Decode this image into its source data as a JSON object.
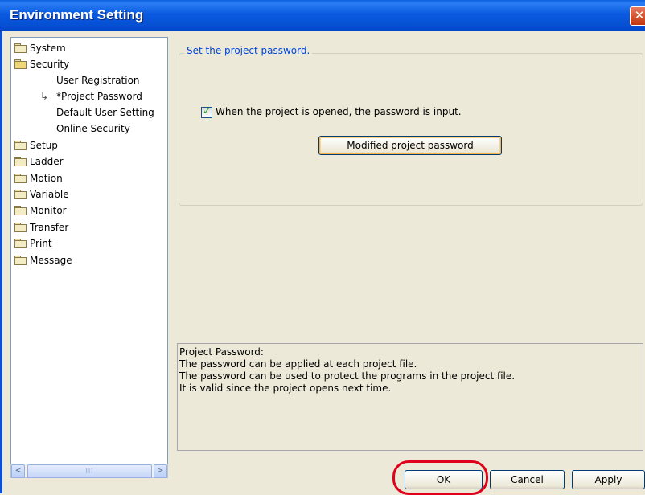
{
  "window": {
    "title": "Environment Setting",
    "close_icon": "close-icon"
  },
  "tree": {
    "items": [
      {
        "label": "System",
        "level": 0,
        "icon": "folder-icon"
      },
      {
        "label": "Security",
        "level": 0,
        "icon": "folder-open-icon"
      },
      {
        "label": "User Registration",
        "level": 1
      },
      {
        "label": "*Project Password",
        "level": 1,
        "icon": "arrow-icon",
        "selected": true
      },
      {
        "label": "Default User Setting",
        "level": 1
      },
      {
        "label": "Online Security",
        "level": 1
      },
      {
        "label": "Setup",
        "level": 0,
        "icon": "folder-icon"
      },
      {
        "label": "Ladder",
        "level": 0,
        "icon": "folder-icon"
      },
      {
        "label": "Motion",
        "level": 0,
        "icon": "folder-icon"
      },
      {
        "label": "Variable",
        "level": 0,
        "icon": "folder-icon"
      },
      {
        "label": "Monitor",
        "level": 0,
        "icon": "folder-icon"
      },
      {
        "label": "Transfer",
        "level": 0,
        "icon": "folder-icon"
      },
      {
        "label": "Print",
        "level": 0,
        "icon": "folder-icon"
      },
      {
        "label": "Message",
        "level": 0,
        "icon": "folder-icon"
      }
    ]
  },
  "scroll": {
    "left": "<",
    "right": ">",
    "thumb": "III"
  },
  "panel": {
    "group_title": "Set the project password.",
    "checkbox_label": "When the project is opened, the password is input.",
    "checkbox_checked": true,
    "modify_button": "Modified project password"
  },
  "description": {
    "lines": [
      "Project Password:",
      "The password can be applied at each project file.",
      "The password can be used to protect the programs in the project file.",
      "It is valid since the project opens next time."
    ]
  },
  "buttons": {
    "ok": "OK",
    "cancel": "Cancel",
    "apply": "Apply"
  },
  "colors": {
    "title_bar": "#0a5ae0",
    "legend_text": "#0046d5",
    "highlight_ring": "#e0001b",
    "dialog_bg": "#ece9d8"
  }
}
